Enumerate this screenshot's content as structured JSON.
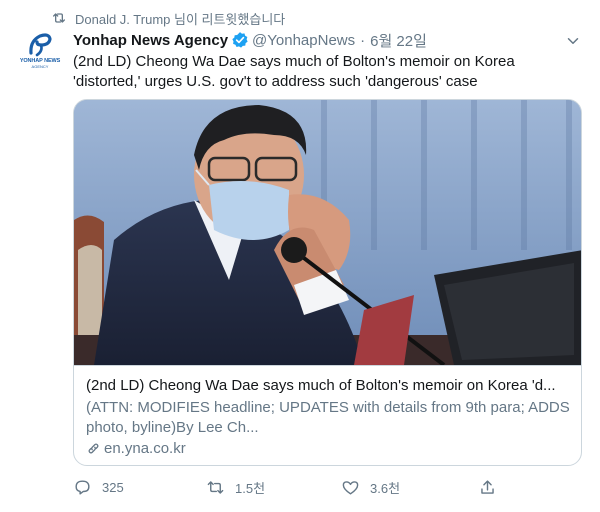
{
  "retweet_notice": {
    "text": "Donald J. Trump 님이 리트윗했습니다",
    "icon": "retweet-icon"
  },
  "author": {
    "name": "Yonhap News Agency",
    "handle": "@YonhapNews",
    "separator": "·",
    "date": "6월 22일",
    "verified": true,
    "avatar": {
      "logo_text": "YONHAP NEWS",
      "logo_sub": "AGENCY",
      "brand_color": "#1a5ea8"
    }
  },
  "tweet": {
    "text_line1": "(2nd LD) Cheong Wa Dae says much of Bolton's memoir on Korea",
    "text_line2": "'distorted,' urges U.S. gov't to address such 'dangerous' case"
  },
  "card": {
    "title": "(2nd LD) Cheong Wa Dae says much of Bolton's memoir on Korea 'd...",
    "description": "(ATTN: MODIFIES headline; UPDATES with details from 9th para; ADDS photo, byline)By Lee Ch...",
    "domain": "en.yna.co.kr",
    "image_subject": "official-wearing-face-mask-at-microphone"
  },
  "actions": {
    "reply": {
      "icon": "reply-icon",
      "count": "325"
    },
    "retweet": {
      "icon": "retweet-icon",
      "count": "1.5천"
    },
    "like": {
      "icon": "heart-icon",
      "count": "3.6천"
    },
    "share": {
      "icon": "share-icon",
      "count": ""
    }
  },
  "colors": {
    "text": "#14171a",
    "secondary": "#657786",
    "border": "#ccd6dd",
    "verified": "#1da1f2"
  }
}
